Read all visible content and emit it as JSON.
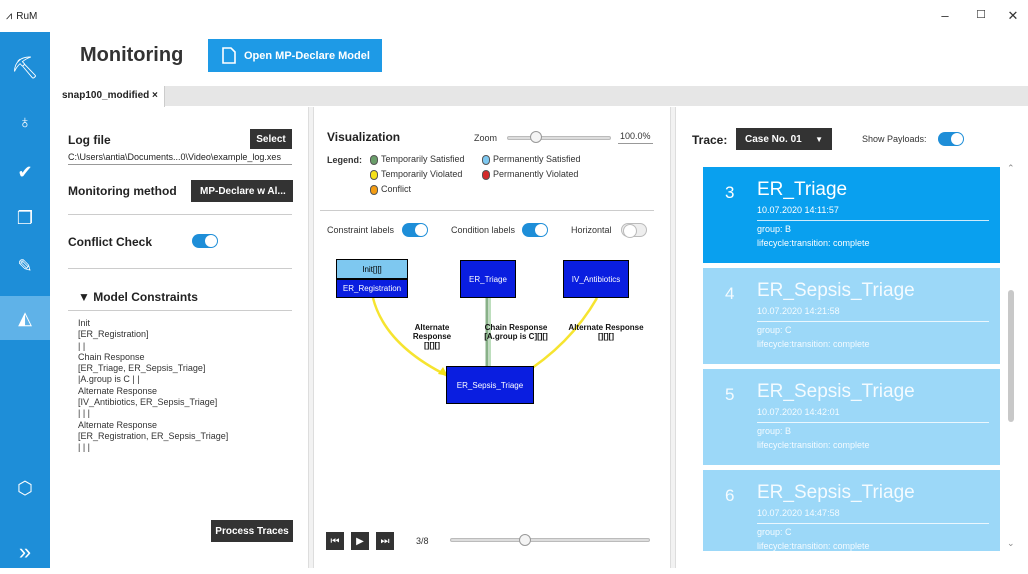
{
  "app": {
    "title": "RuM",
    "icon": "rum-logo-icon"
  },
  "window_controls": {
    "minimize": "–",
    "maximize": "☐",
    "close": "✕"
  },
  "sidebar": {
    "items": [
      {
        "icon": "logo-icon",
        "glyph": "⛏"
      },
      {
        "icon": "lightbulb-icon",
        "glyph": "♁"
      },
      {
        "icon": "check-icon",
        "glyph": "✔"
      },
      {
        "icon": "copy-icon",
        "glyph": "❐"
      },
      {
        "icon": "edit-icon",
        "glyph": "✎"
      },
      {
        "icon": "chart-area-icon",
        "glyph": "◭"
      },
      {
        "icon": "cube-icon",
        "glyph": "⬡"
      },
      {
        "icon": "expand-icon",
        "glyph": "»"
      }
    ]
  },
  "header": {
    "title": "Monitoring",
    "open_button": "Open MP-Declare Model"
  },
  "tab": {
    "label": "snap100_modified",
    "close": "×"
  },
  "left": {
    "log_file_label": "Log file",
    "select_button": "Select",
    "log_file_path": "C:\\Users\\antia\\Documents...0\\Video\\example_log.xes",
    "method_label": "Monitoring method",
    "method_value": "MP-Declare w Al...",
    "conflict_label": "Conflict Check",
    "model_constraints_label": "▼  Model Constraints",
    "constraints": [
      "Init",
      "[ER_Registration]",
      "| |",
      "Chain Response",
      "[ER_Triage, ER_Sepsis_Triage]",
      "|A.group is C | |",
      "Alternate Response",
      "[IV_Antibiotics, ER_Sepsis_Triage]",
      "| | |",
      "Alternate Response",
      "[ER_Registration, ER_Sepsis_Triage]",
      "| | |"
    ],
    "process_button": "Process Traces"
  },
  "middle": {
    "visualization_label": "Visualization",
    "zoom_label": "Zoom",
    "zoom_value": "100.0%",
    "zoom_level": 0.28,
    "legend_label": "Legend:",
    "legend": [
      {
        "label": "Temporarily Satisfied",
        "color": "#6a9e6a"
      },
      {
        "label": "Permanently Satisfied",
        "color": "#7ec8f0"
      },
      {
        "label": "Temporarily Violated",
        "color": "#f5e11a"
      },
      {
        "label": "Permanently Violated",
        "color": "#d32a2a"
      },
      {
        "label": "Conflict",
        "color": "#f39c12"
      }
    ],
    "constraint_labels": "Constraint labels",
    "condition_labels": "Condition labels",
    "horizontal_label": "Horizontal",
    "nodes": {
      "init_top": "Init[][]",
      "er_registration": "ER_Registration",
      "er_triage": "ER_Triage",
      "iv_antibiotics": "IV_Antibiotics",
      "er_sepsis_triage": "ER_Sepsis_Triage"
    },
    "edges": {
      "alt_resp_1": "Alternate Response",
      "alt_resp_1_sub": "[][][]",
      "chain_resp": "Chain Response",
      "chain_resp_sub": "[A.group is C][][]",
      "alt_resp_2": "Alternate Response",
      "alt_resp_2_sub": "[][][]"
    },
    "playback": {
      "first": "⏮",
      "play": "▶",
      "last": "⏭",
      "counter": "3/8",
      "position": 3,
      "total": 8
    }
  },
  "right": {
    "trace_label": "Trace:",
    "trace_value": "Case No. 01",
    "payloads_label": "Show Payloads:",
    "cards": [
      {
        "num": "3",
        "name": "ER_Triage",
        "time": "10.07.2020 14:11:57",
        "p1": "group: B",
        "p2": "lifecycle:transition: complete",
        "selected": true
      },
      {
        "num": "4",
        "name": "ER_Sepsis_Triage",
        "time": "10.07.2020 14:21:58",
        "p1": "group: C",
        "p2": "lifecycle:transition: complete",
        "selected": false
      },
      {
        "num": "5",
        "name": "ER_Sepsis_Triage",
        "time": "10.07.2020 14:42:01",
        "p1": "group: B",
        "p2": "lifecycle:transition: complete",
        "selected": false
      },
      {
        "num": "6",
        "name": "ER_Sepsis_Triage",
        "time": "10.07.2020 14:47:58",
        "p1": "group: C",
        "p2": "lifecycle:transition: complete",
        "selected": false
      }
    ]
  }
}
